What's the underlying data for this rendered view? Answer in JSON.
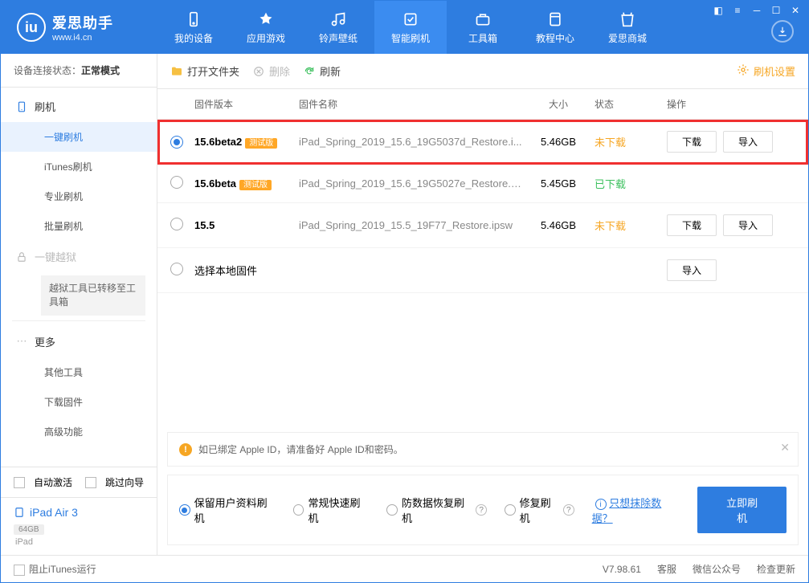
{
  "header": {
    "app_name": "爱思助手",
    "app_domain": "www.i4.cn",
    "tabs": [
      "我的设备",
      "应用游戏",
      "铃声壁纸",
      "智能刷机",
      "工具箱",
      "教程中心",
      "爱思商城"
    ],
    "active_tab": 3
  },
  "sidebar": {
    "status_label": "设备连接状态：",
    "status_value": "正常模式",
    "flash_section": "刷机",
    "items": [
      "一键刷机",
      "iTunes刷机",
      "专业刷机",
      "批量刷机"
    ],
    "selected": 0,
    "jailbreak_section": "一键越狱",
    "jailbreak_note": "越狱工具已转移至工具箱",
    "more_section": "更多",
    "more_items": [
      "其他工具",
      "下载固件",
      "高级功能"
    ],
    "auto_activate": "自动激活",
    "skip_guide": "跳过向导",
    "device_name": "iPad Air 3",
    "device_storage": "64GB",
    "device_type": "iPad"
  },
  "toolbar": {
    "open_folder": "打开文件夹",
    "delete": "删除",
    "refresh": "刷新",
    "settings": "刷机设置"
  },
  "table": {
    "headers": {
      "version": "固件版本",
      "name": "固件名称",
      "size": "大小",
      "status": "状态",
      "actions": "操作"
    },
    "download_btn": "下载",
    "import_btn": "导入",
    "local_label": "选择本地固件",
    "rows": [
      {
        "version": "15.6beta2",
        "beta": "测试版",
        "name": "iPad_Spring_2019_15.6_19G5037d_Restore.i...",
        "size": "5.46GB",
        "status": "未下载",
        "status_cls": "not",
        "checked": true,
        "highlighted": true,
        "show_download": true,
        "show_import": true
      },
      {
        "version": "15.6beta",
        "beta": "测试版",
        "name": "iPad_Spring_2019_15.6_19G5027e_Restore.ip...",
        "size": "5.45GB",
        "status": "已下载",
        "status_cls": "done",
        "checked": false,
        "highlighted": false,
        "show_download": false,
        "show_import": false
      },
      {
        "version": "15.5",
        "beta": "",
        "name": "iPad_Spring_2019_15.5_19F77_Restore.ipsw",
        "size": "5.46GB",
        "status": "未下载",
        "status_cls": "not",
        "checked": false,
        "highlighted": false,
        "show_download": true,
        "show_import": true
      }
    ]
  },
  "notice": "如已绑定 Apple ID，请准备好 Apple ID和密码。",
  "options": {
    "items": [
      "保留用户资料刷机",
      "常规快速刷机",
      "防数据恢复刷机",
      "修复刷机"
    ],
    "selected": 0,
    "info_link": "只想抹除数据？",
    "primary": "立即刷机"
  },
  "footer": {
    "block_itunes": "阻止iTunes运行",
    "version": "V7.98.61",
    "support": "客服",
    "wechat": "微信公众号",
    "check_update": "检查更新"
  }
}
